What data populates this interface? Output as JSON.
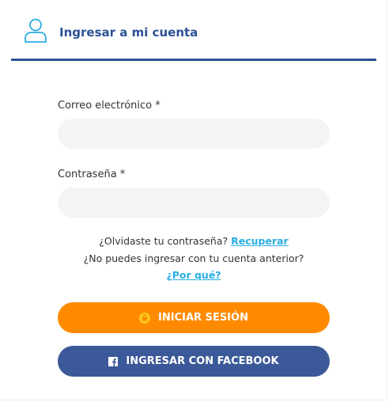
{
  "header": {
    "title": "Ingresar a mi cuenta",
    "icon": "user-icon",
    "accent": "#2c5294"
  },
  "form": {
    "email_label": "Correo electrónico *",
    "email_value": "",
    "password_label": "Contraseña *",
    "password_value": ""
  },
  "help": {
    "forgot_text": "¿Olvidaste tu contraseña?",
    "recover_link": "Recuperar",
    "old_account_text": "¿No puedes ingresar con tu cuenta anterior?",
    "why_link": "¿Por qué?"
  },
  "buttons": {
    "login_label": "INICIAR SESIÓN",
    "login_icon": "lock-icon",
    "login_color": "#ff8a00",
    "facebook_label": "INGRESAR CON FACEBOOK",
    "facebook_icon": "facebook-icon",
    "facebook_color": "#3b5998"
  },
  "colors": {
    "link": "#29aee3"
  }
}
